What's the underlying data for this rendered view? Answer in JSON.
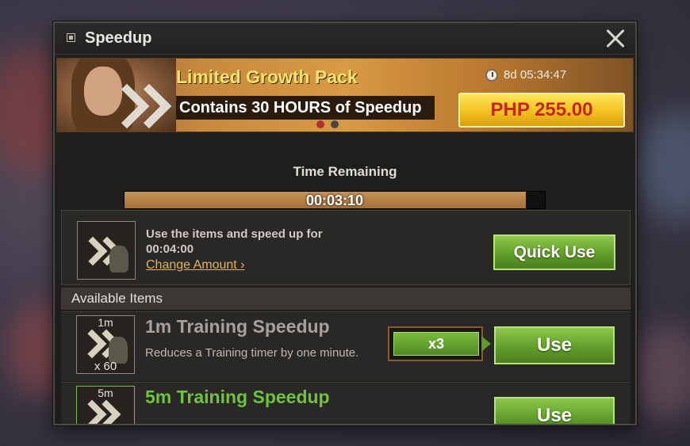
{
  "window": {
    "title": "Speedup"
  },
  "banner": {
    "title": "Limited Growth Pack",
    "subtitle": "Contains 30 HOURS of Speedup",
    "countdown": "8d 05:34:47",
    "price": "PHP 255.00",
    "page_count": 2,
    "active_page": 1
  },
  "timer": {
    "label": "Time Remaining",
    "value": "00:03:10",
    "progress_fraction": 0.955
  },
  "quick_use": {
    "line1": "Use the items and speed up for",
    "line2": "00:04:00",
    "change_label": "Change Amount",
    "change_arrow": "›",
    "button_label": "Quick Use"
  },
  "available": {
    "header": "Available Items",
    "items": [
      {
        "badge_top": "1m",
        "badge_bottom": "x 60",
        "name": "1m Training Speedup",
        "name_color": "#a6a29b",
        "description": "Reduces a Training timer by one minute.",
        "quantity": "x3",
        "button_label": "Use"
      },
      {
        "badge_top": "5m",
        "name": "5m Training Speedup",
        "name_color": "#6ec43a",
        "button_label": "Use"
      }
    ]
  },
  "colors": {
    "accent_green": "#5e9a28",
    "price_red": "#c8241a",
    "gold": "#f6e36a"
  },
  "icons": {
    "title": "window-icon",
    "close": "close-icon",
    "clock": "clock-icon",
    "speedup": "speedup-chevron-icon"
  }
}
